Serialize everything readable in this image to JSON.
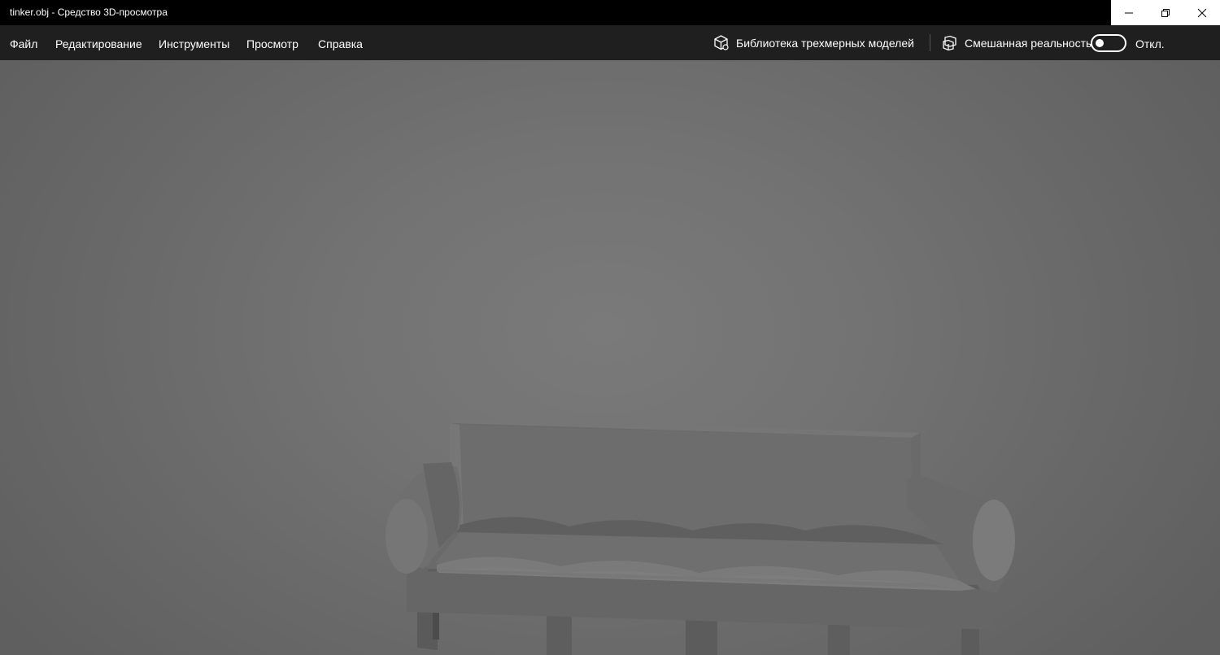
{
  "window": {
    "title": "tinker.obj - Средство 3D-просмотра",
    "controls": {
      "minimize_icon": "minimize-icon",
      "restore_icon": "restore-icon",
      "close_icon": "close-icon"
    }
  },
  "menu": {
    "items": [
      "Файл",
      "Редактирование",
      "Инструменты",
      "Просмотр",
      "Справка"
    ]
  },
  "toolbar": {
    "library_label": "Библиотека трехмерных моделей",
    "library_icon": "3d-cube-icon",
    "mixed_reality_label": "Смешанная реальность",
    "mixed_reality_icon": "mixed-reality-icon",
    "toggle_state_label": "Откл.",
    "toggle_on": false
  },
  "viewport": {
    "model": "sofa-3d-model",
    "background_color": "#6e6e6e"
  }
}
